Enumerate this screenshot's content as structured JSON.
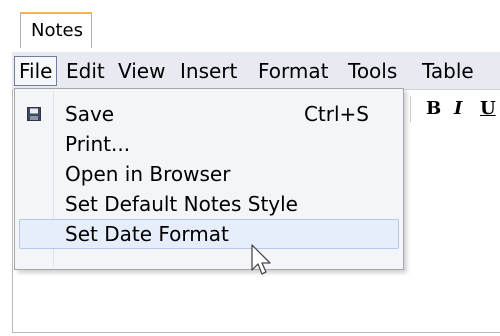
{
  "tab": {
    "label": "Notes"
  },
  "menubar": {
    "items": [
      {
        "label": "File"
      },
      {
        "label": "Edit"
      },
      {
        "label": "View"
      },
      {
        "label": "Insert"
      },
      {
        "label": "Format"
      },
      {
        "label": "Tools"
      },
      {
        "label": "Table"
      }
    ]
  },
  "toolbar": {
    "bold_label": "B",
    "italic_label": "I",
    "underline_label": "U"
  },
  "file_menu": {
    "items": [
      {
        "label": "Save",
        "shortcut": "Ctrl+S",
        "icon": "save-icon"
      },
      {
        "label": "Print..."
      },
      {
        "label": "Open in Browser"
      },
      {
        "label": "Set Default Notes Style"
      },
      {
        "label": "Set Date Format"
      }
    ]
  },
  "colors": {
    "menubar_bg": "#e7eaf1",
    "menu_bg": "#f4f5f8",
    "hover_bg": "#e6eefb",
    "tab_accent": "#f0b94a"
  }
}
